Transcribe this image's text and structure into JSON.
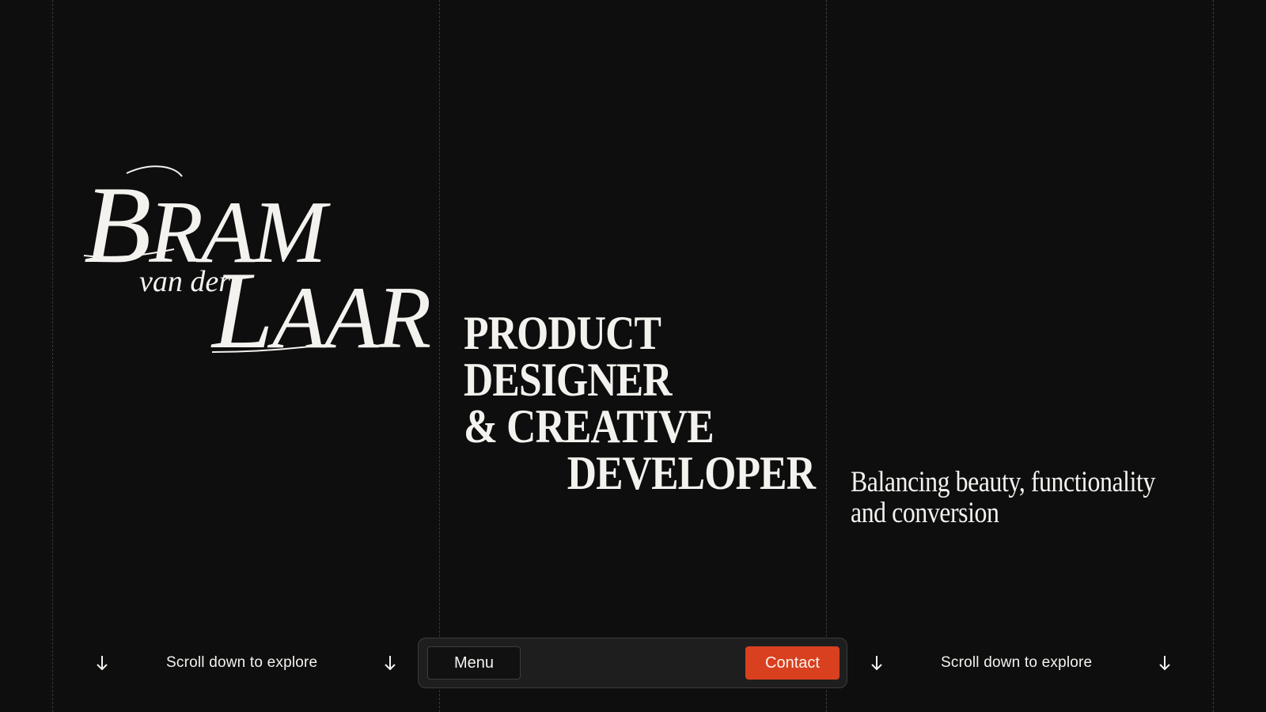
{
  "brand": {
    "first_cap": "B",
    "first_rest": "RAM",
    "middle": "van der",
    "last_cap": "L",
    "last_rest": "AAR"
  },
  "headline": {
    "line1": "PRODUCT",
    "line2": "DESIGNER",
    "line3": "& CREATIVE",
    "line4": "DEVELOPER"
  },
  "tagline": "Balancing beauty, functionality and conversion",
  "scroll_left": {
    "label": "Scroll down to explore",
    "icon": "arrow-down-icon"
  },
  "scroll_right": {
    "label": "Scroll down to explore",
    "icon": "arrow-down-icon"
  },
  "nav": {
    "menu_label": "Menu",
    "contact_label": "Contact"
  },
  "colors": {
    "background": "#0f0e0e",
    "foreground": "#f4f2ee",
    "accent": "#d8401f",
    "navbar": "#1f1e1e"
  }
}
